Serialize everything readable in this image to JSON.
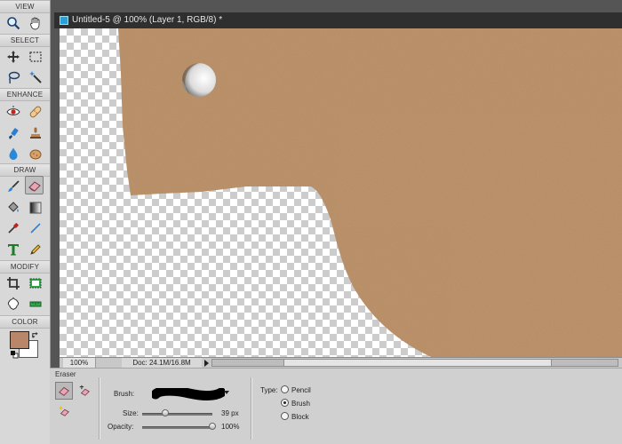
{
  "toolbox": {
    "sections": {
      "view": "VIEW",
      "select": "SELECT",
      "enhance": "ENHANCE",
      "draw": "DRAW",
      "modify": "MODIFY",
      "color": "COLOR"
    },
    "tools": [
      {
        "name": "zoom-tool",
        "icon": "magnifier-icon"
      },
      {
        "name": "hand-tool",
        "icon": "hand-icon"
      },
      {
        "name": "move-tool",
        "icon": "move-arrows-icon"
      },
      {
        "name": "marquee-tool",
        "icon": "dashed-rectangle-icon"
      },
      {
        "name": "lasso-tool",
        "icon": "lasso-icon"
      },
      {
        "name": "magic-wand-tool",
        "icon": "magic-wand-icon"
      },
      {
        "name": "red-eye-tool",
        "icon": "eye-icon"
      },
      {
        "name": "spot-healing-tool",
        "icon": "bandage-icon"
      },
      {
        "name": "smart-brush-tool",
        "icon": "smart-brush-icon"
      },
      {
        "name": "clone-stamp-tool",
        "icon": "stamp-icon"
      },
      {
        "name": "blur-tool",
        "icon": "drop-icon"
      },
      {
        "name": "sponge-tool",
        "icon": "sponge-icon"
      },
      {
        "name": "brush-tool",
        "icon": "paintbrush-icon"
      },
      {
        "name": "eraser-tool",
        "icon": "eraser-icon",
        "selected": true
      },
      {
        "name": "paint-bucket-tool",
        "icon": "paint-bucket-icon"
      },
      {
        "name": "gradient-tool",
        "icon": "gradient-icon"
      },
      {
        "name": "eyedropper-tool",
        "icon": "eyedropper-icon"
      },
      {
        "name": "line-tool",
        "icon": "line-icon"
      },
      {
        "name": "type-tool",
        "icon": "type-T-icon"
      },
      {
        "name": "pencil-tool",
        "icon": "pencil-icon"
      },
      {
        "name": "crop-tool",
        "icon": "crop-icon"
      },
      {
        "name": "recompose-tool",
        "icon": "recompose-icon"
      },
      {
        "name": "cookie-cutter-tool",
        "icon": "cookie-cutter-icon"
      },
      {
        "name": "straighten-tool",
        "icon": "straighten-icon"
      }
    ],
    "colors": {
      "foreground": "#b8876a",
      "background": "#ffffff"
    }
  },
  "document": {
    "title": "Untitled-5 @ 100% (Layer 1, RGB/8) *",
    "zoom": "100%",
    "doc_size": "Doc: 24.1M/16.8M",
    "colors": {
      "cardboard": "#c1956c",
      "cardboard_dark": "#ab7f58",
      "title_bar": "#2f2f2f"
    }
  },
  "options": {
    "panel_title": "Eraser",
    "tools": [
      {
        "name": "eraser",
        "icon": "eraser-icon",
        "selected": true
      },
      {
        "name": "background-eraser",
        "icon": "background-eraser-icon"
      },
      {
        "name": "magic-eraser",
        "icon": "magic-eraser-icon"
      }
    ],
    "brush_label": "Brush:",
    "size_label": "Size:",
    "size_value": "39 px",
    "size_fraction": 0.33,
    "opacity_label": "Opacity:",
    "opacity_value": "100%",
    "opacity_fraction": 1.0,
    "type_label": "Type:",
    "type_options": [
      {
        "label": "Pencil",
        "checked": false
      },
      {
        "label": "Brush",
        "checked": true
      },
      {
        "label": "Block",
        "checked": false
      }
    ]
  }
}
